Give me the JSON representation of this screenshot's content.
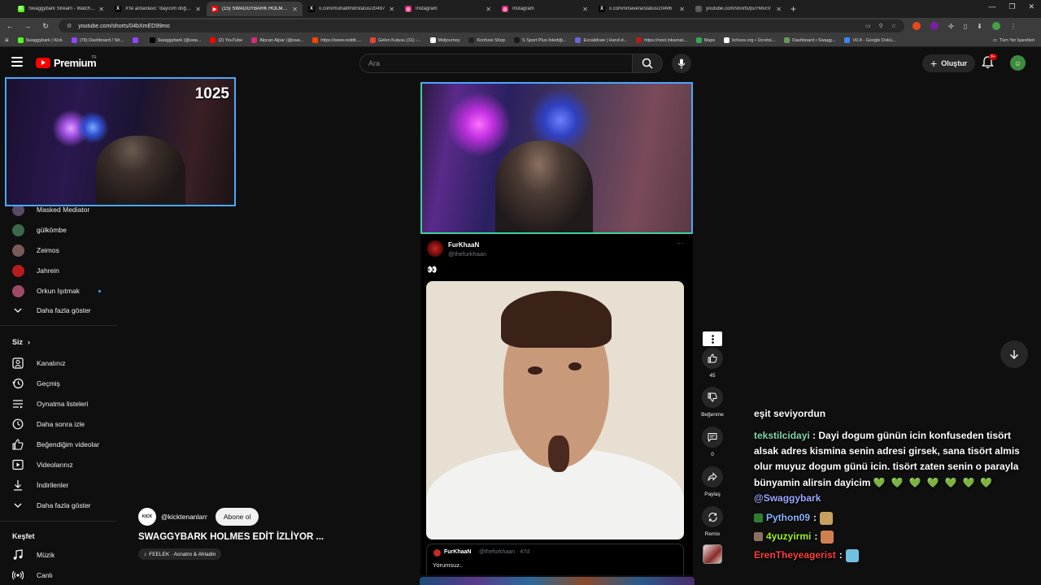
{
  "browser": {
    "tabs": [
      {
        "title": "Swaggybark Stream - Watch Liv",
        "color": "#53fc18",
        "glyph": "K",
        "active": false
      },
      {
        "title": "X'te ardardavc \"dayıcım doğum",
        "color": "#000000",
        "glyph": "X",
        "active": false
      },
      {
        "title": "(15) SWAGGYBARK HOLMES EDİ",
        "color": "#ff0000",
        "glyph": "▶",
        "active": true
      },
      {
        "title": "x.com/muhalifmd/status/20497",
        "color": "#000000",
        "glyph": "X",
        "active": false
      },
      {
        "title": "Instagram",
        "color": "#d62976",
        "glyph": "◎",
        "active": false
      },
      {
        "title": "Instagram",
        "color": "#d62976",
        "glyph": "◎",
        "active": false
      },
      {
        "title": "x.com/nmavera/status/20496",
        "color": "#000000",
        "glyph": "X",
        "active": false
      },
      {
        "title": "youtube.com/shorts/puYMvcV",
        "color": "#555555",
        "glyph": "◌",
        "active": false
      }
    ],
    "url": "youtube.com/shorts/04bXmED99mo",
    "bookmarks": [
      {
        "label": "Swaggybark | Kick",
        "color": "#53fc18"
      },
      {
        "label": "(79) Dashboard / Str...",
        "color": "#9146ff"
      },
      {
        "label": "",
        "color": "#9146ff"
      },
      {
        "label": "Swaggybark (@swa...",
        "color": "#000000"
      },
      {
        "label": "(2) YouTube",
        "color": "#ff0000"
      },
      {
        "label": "Alpcan Alpar (@swa...",
        "color": "#d62976"
      },
      {
        "label": "https://www.reddit....",
        "color": "#ff4500"
      },
      {
        "label": "Gelen Kutusu (31) -...",
        "color": "#ea4335"
      },
      {
        "label": "Midjourney",
        "color": "#ffffff"
      },
      {
        "label": "Konfuse Shop",
        "color": "#222222"
      },
      {
        "label": "S Sport Plus-İstediği...",
        "color": "#1a1a1a"
      },
      {
        "label": "Excalidraw | Hand-d...",
        "color": "#6965db"
      },
      {
        "label": "https://next.inkarnat...",
        "color": "#b71c1c"
      },
      {
        "label": "Maps",
        "color": "#34a853"
      },
      {
        "label": "lichess.org • Ücretsi...",
        "color": "#ffffff"
      },
      {
        "label": "Dashboard • Swagg...",
        "color": "#6a994e"
      },
      {
        "label": "V0.8 - Google Dokü...",
        "color": "#4285f4"
      }
    ],
    "bookmarks_right": "Tüm Yer İşaretleri"
  },
  "youtube": {
    "brand": "Premium",
    "country": "TR",
    "search_placeholder": "Ara",
    "create_label": "Oluştur",
    "notif_count": "9+",
    "sidebar": {
      "subscriptions": [
        {
          "label": "Masked Mediator",
          "color": "#5a4a6a",
          "live": false
        },
        {
          "label": "gülkömbe",
          "color": "#3a6a4a",
          "live": false
        },
        {
          "label": "Zeimos",
          "color": "#7a5a5a",
          "live": false
        },
        {
          "label": "Jahrein",
          "color": "#b71c1c",
          "live": false
        },
        {
          "label": "Orkun Işıtmak",
          "color": "#a04a6a",
          "live": true
        }
      ],
      "show_more_1": "Daha fazla göster",
      "you_header": "Siz",
      "you_items": [
        "Kanalınız",
        "Geçmiş",
        "Oynatma listeleri",
        "Daha sonra izle",
        "Beğendiğim videolar",
        "Videolarınız",
        "İndirilenler"
      ],
      "show_more_2": "Daha fazla göster",
      "explore_header": "Keşfet",
      "explore_items": [
        "Müzik",
        "Canlı"
      ]
    }
  },
  "stream_overlay": {
    "counter": "1025"
  },
  "tweet": {
    "name": "FurKhaaN",
    "handle": "@thefurkhaan",
    "emoji": "👀",
    "quote_name": "FurKhaaN",
    "quote_handle": "@thefurkhaan · 47d",
    "quote_text": "Yorumsuz.."
  },
  "short": {
    "channel": "@kicktenanlarr",
    "channel_avatar_text": "KICK",
    "subscribe_label": "Abone ol",
    "title": "SWAGGYBARK HOLMES EDİT İZLİYOR ...",
    "music": "FEELEK · Acnatro & Ahladin",
    "likes": "45",
    "dislike_label": "Beğenme",
    "comments": "0",
    "share_label": "Paylaş",
    "remix_label": "Remix"
  },
  "chat": {
    "cut_text": "eşit seviyordun",
    "long_message": {
      "user": "tekstilcidayi",
      "text": "Dayi dogum günün icin konfuseden tisört alsak adres kismina senin adresi girsek, sana tisört almis olur muyuz dogum günü icin. tisört zaten senin o parayla bünyamin alirsin dayicim",
      "hearts": "💚💚💚💚💚💚💚",
      "mention": "@Swaggybark"
    },
    "messages": [
      {
        "user": "Python09",
        "color": "#8ab4ff",
        "badge_color": "#2e7d32",
        "emote_color": "#c8a060"
      },
      {
        "user": "4yuzyirmi",
        "color": "#9ef01a",
        "badge_color": "#8d6e63",
        "emote_color": "#d08050"
      },
      {
        "user": "ErenTheyeagerist",
        "color": "#ff3d3d",
        "badge_color": "",
        "emote_color": "#70c0e0"
      }
    ]
  }
}
